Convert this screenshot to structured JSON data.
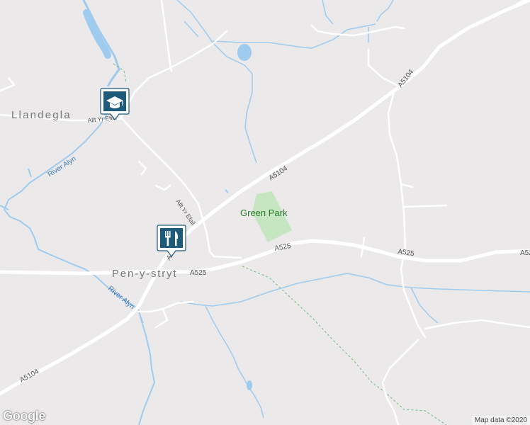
{
  "map": {
    "places": {
      "village_1": "Llandegla",
      "village_2": "Pen-y-stryt",
      "park": "Green Park"
    },
    "roads": {
      "a5104_ne": "A5104",
      "a5104_mid": "A5104",
      "a5104_sw": "A5104",
      "a5104_stub": "A",
      "a525_w": "A525",
      "a525_mid": "A525",
      "a525_e": "A525",
      "a525_far": "A52",
      "allt_1": "Allt Yr Efail",
      "allt_2": "Allt Yr Efail"
    },
    "rivers": {
      "alyn_n": "River Alyn",
      "alyn_s": "River Alyn"
    },
    "pois": [
      {
        "type": "school",
        "icon": "graduation-cap-icon"
      },
      {
        "type": "restaurant",
        "icon": "fork-knife-icon"
      }
    ]
  },
  "footer": {
    "logo": "Google",
    "attribution": "Map data ©2020"
  },
  "colors": {
    "land": "#ebe9e9",
    "road": "#ffffff",
    "water": "#9fcbef",
    "park": "#c6e6c1",
    "poi": "#1e5a7a",
    "path": "#70b87a"
  }
}
